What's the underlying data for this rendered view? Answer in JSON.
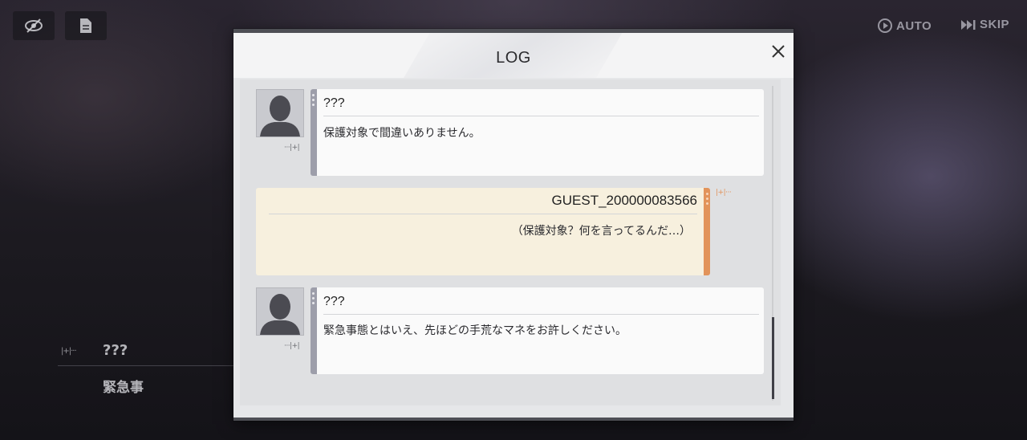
{
  "hud": {
    "auto_label": "AUTO",
    "skip_label": "SKIP"
  },
  "background": {
    "speaker": "???",
    "line": "緊急事"
  },
  "log": {
    "title": "LOG",
    "entries": [
      {
        "speaker": "???",
        "text": "保護対象で間違いありません。",
        "side": "left"
      },
      {
        "speaker": "GUEST_200000083566",
        "text": "（保護対象？何を言ってるんだ…）",
        "side": "right"
      },
      {
        "speaker": "???",
        "text": "緊急事態とはいえ、先ほどの手荒なマネをお許しください。",
        "side": "left"
      }
    ]
  },
  "colors": {
    "npc_accent": "#9d9eaa",
    "player_accent": "#e2935a",
    "player_bubble": "#f7f0de"
  }
}
